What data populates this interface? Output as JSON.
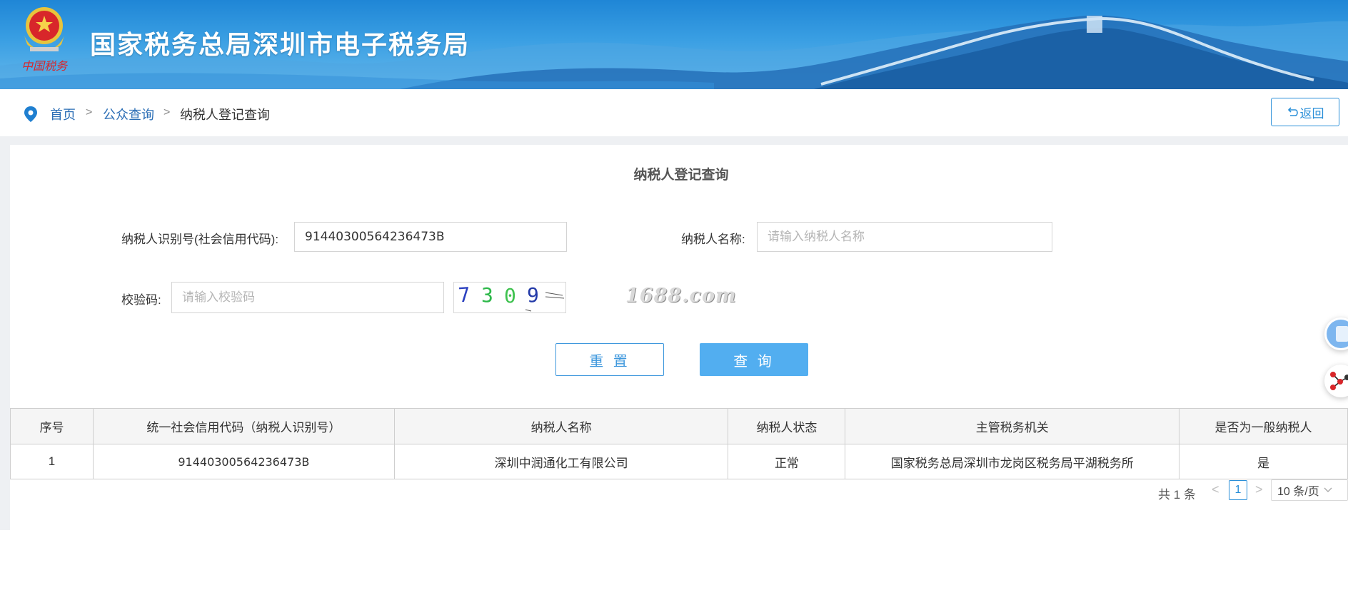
{
  "header": {
    "site_title": "国家税务总局深圳市电子税务局",
    "emblem_text": "中国税务"
  },
  "breadcrumb": {
    "home": "首页",
    "sep1": ">",
    "public_query": "公众查询",
    "sep2": ">",
    "current": "纳税人登记查询"
  },
  "back_button": {
    "icon": "undo-arrow-icon",
    "label": "返回"
  },
  "form": {
    "title": "纳税人登记查询",
    "taxpayer_id_label": "纳税人识别号(社会信用代码):",
    "taxpayer_id_value": "91440300564236473B",
    "taxpayer_name_label": "纳税人名称:",
    "taxpayer_name_placeholder": "请输入纳税人名称",
    "captcha_label": "校验码:",
    "captcha_placeholder": "请输入校验码",
    "captcha_text": "7309",
    "watermark": "1688.com",
    "reset_label": "重 置",
    "query_label": "查 询"
  },
  "table": {
    "columns": [
      "序号",
      "统一社会信用代码（纳税人识别号）",
      "纳税人名称",
      "纳税人状态",
      "主管税务机关",
      "是否为一般纳税人"
    ],
    "rows": [
      [
        "1",
        "91440300564236473B",
        "深圳中润通化工有限公司",
        "正常",
        "国家税务总局深圳市龙岗区税务局平湖税务所",
        "是"
      ]
    ]
  },
  "pagination": {
    "total": "共 1 条",
    "prev": "<",
    "current_page": "1",
    "next": ">",
    "page_size": "10 条/页"
  },
  "colors": {
    "banner_blue": "#1f86d6",
    "link_blue": "#2a6db5",
    "accent_blue": "#52aef0",
    "border_gray": "#cfcfcf"
  }
}
